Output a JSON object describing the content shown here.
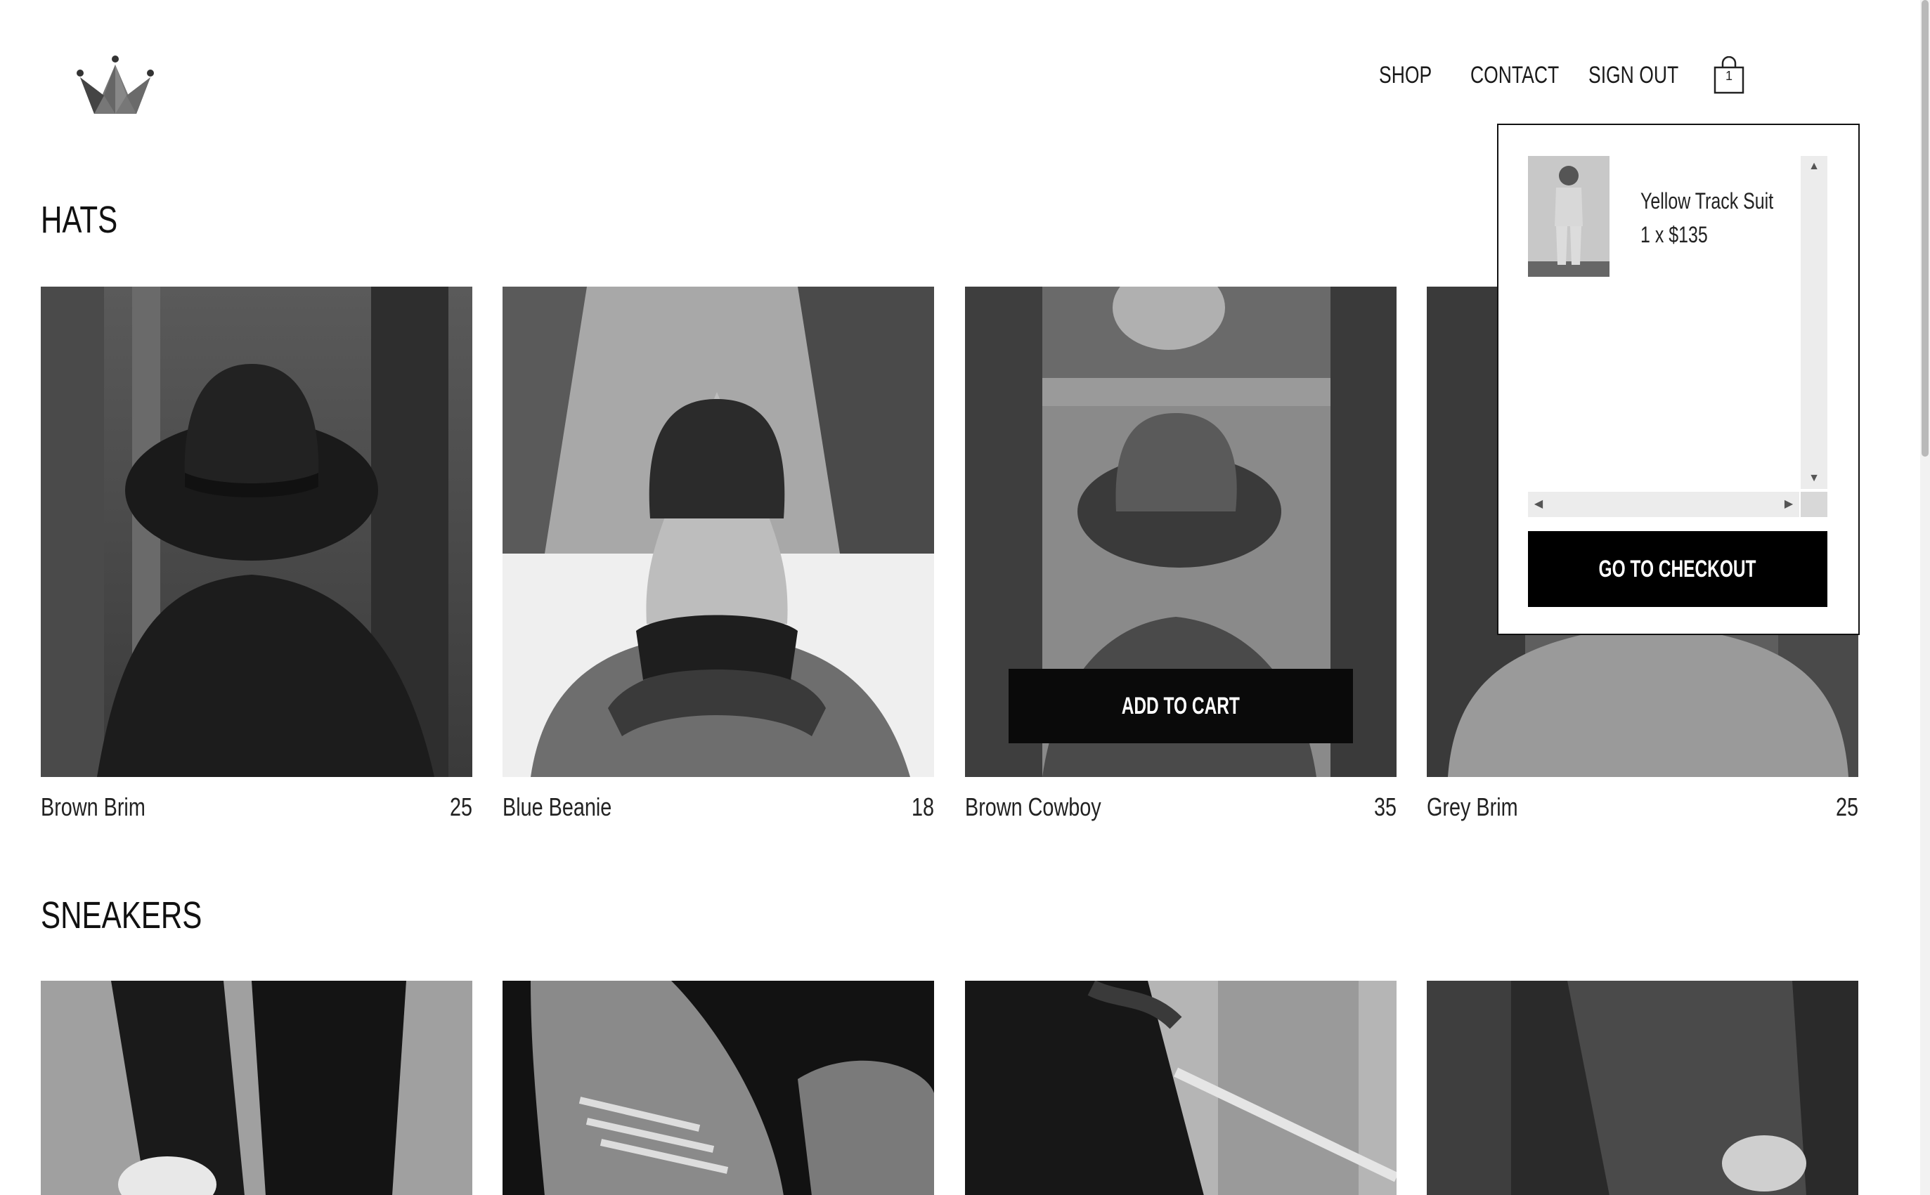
{
  "nav": {
    "shop": "SHOP",
    "contact": "CONTACT",
    "sign_out": "SIGN OUT",
    "cart_count": "1"
  },
  "sections": {
    "hats": {
      "title": "HATS",
      "items": [
        {
          "name": "Brown Brim",
          "price": "25"
        },
        {
          "name": "Blue Beanie",
          "price": "18"
        },
        {
          "name": "Brown Cowboy",
          "price": "35"
        },
        {
          "name": "Grey Brim",
          "price": "25"
        }
      ],
      "add_to_cart": "ADD TO CART"
    },
    "sneakers": {
      "title": "SNEAKERS"
    }
  },
  "cart_dropdown": {
    "items": [
      {
        "name": "Yellow Track Suit",
        "quantity_price": "1 x $135"
      }
    ],
    "checkout_label": "GO TO CHECKOUT"
  },
  "icons": {
    "logo": "crown-icon",
    "cart": "shopping-bag-icon"
  }
}
